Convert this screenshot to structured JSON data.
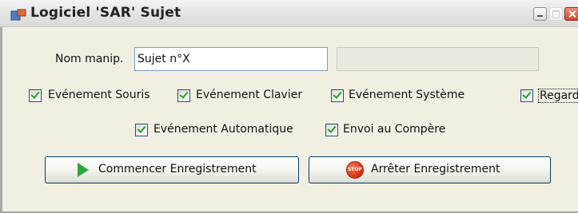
{
  "window": {
    "title": "Logiciel 'SAR' Sujet"
  },
  "form": {
    "name_label": "Nom manip.",
    "name_value": "Sujet n°X",
    "secondary_value": ""
  },
  "checkboxes": [
    {
      "label": "Evénement Souris",
      "checked": true
    },
    {
      "label": "Evénement Clavier",
      "checked": true
    },
    {
      "label": "Evénement Système",
      "checked": true
    },
    {
      "label": "Regard",
      "checked": true
    },
    {
      "label": "Evénement Automatique",
      "checked": true
    },
    {
      "label": "Envoi au Compère",
      "checked": true
    }
  ],
  "buttons": {
    "start_label": "Commencer Enregistrement",
    "stop_label": "Arrêter Enregistrement",
    "stop_icon_text": "STOP"
  },
  "colors": {
    "accent_green": "#2fa63a",
    "stop_red": "#d32b12",
    "face": "#f1efe2"
  }
}
